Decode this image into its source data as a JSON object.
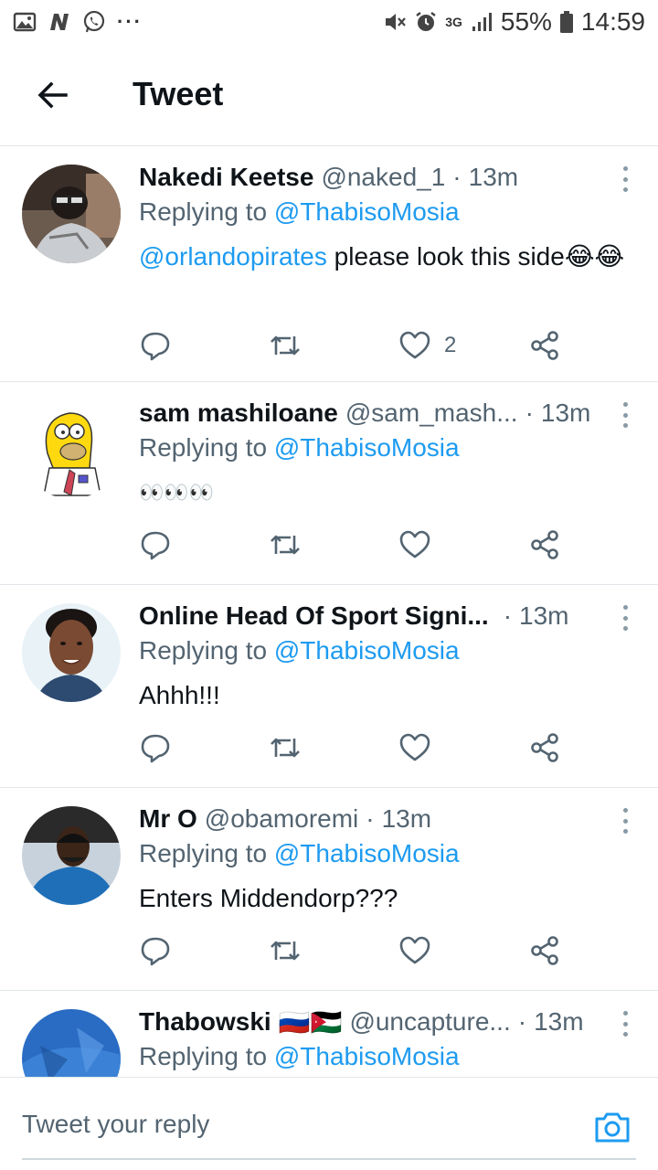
{
  "status_bar": {
    "battery": "55%",
    "time": "14:59",
    "network": "3G",
    "icons": [
      "gallery-icon",
      "n-app-icon",
      "whatsapp-icon",
      "more-dots-icon",
      "mute-icon",
      "alarm-icon",
      "signal-icon",
      "battery-icon"
    ]
  },
  "header": {
    "title": "Tweet",
    "back_icon": "arrow-left-icon"
  },
  "tweets": [
    {
      "name": "Nakedi Keetse",
      "handle": "@naked_1",
      "time": "13m",
      "replying_prefix": "Replying to ",
      "replying_to": "@ThabisoMosia",
      "body_mention": "@orlandopirates",
      "body_text": " please look this side",
      "body_emoji": "😂😂",
      "likes": "2"
    },
    {
      "name": "sam mashiloane",
      "handle": "@sam_mash...",
      "time": "13m",
      "replying_prefix": "Replying to ",
      "replying_to": "@ThabisoMosia",
      "body_text": "👀👀👀",
      "likes": ""
    },
    {
      "name": "Online Head Of Sport Signi...",
      "handle": "",
      "time": "13m",
      "replying_prefix": "Replying to ",
      "replying_to": "@ThabisoMosia",
      "body_text": "Ahhh!!!",
      "likes": ""
    },
    {
      "name": "Mr O",
      "handle": "@obamoremi",
      "time": "13m",
      "replying_prefix": "Replying to ",
      "replying_to": "@ThabisoMosia",
      "body_text": "Enters Middendorp???",
      "likes": ""
    },
    {
      "name": "Thabowski",
      "name_flags": "🇷🇺🇯🇴",
      "handle": "@uncapture...",
      "time": "13m",
      "replying_prefix": "Replying to ",
      "replying_to": "@ThabisoMosia",
      "body_text": "",
      "likes": ""
    }
  ],
  "reply_bar": {
    "placeholder": "Tweet your reply",
    "camera_icon": "camera-icon"
  },
  "colors": {
    "accent": "#1d9bf0",
    "text": "#0f1419",
    "secondary": "#536471",
    "divider": "#e1e6ea"
  }
}
